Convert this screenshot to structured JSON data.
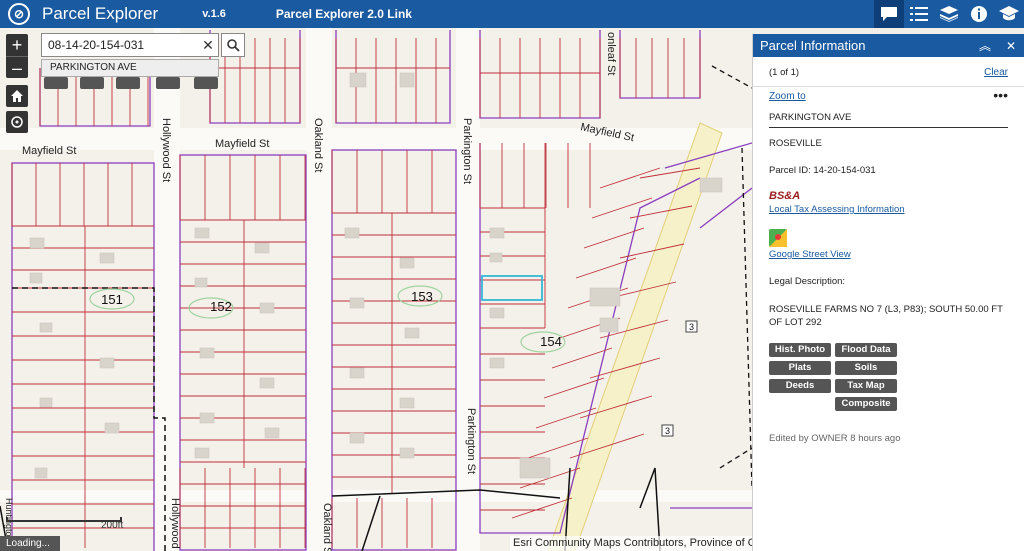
{
  "header": {
    "title": "Parcel Explorer",
    "version": "v.1.6",
    "link_label": "Parcel Explorer 2.0 Link"
  },
  "search": {
    "value": "08-14-20-154-031",
    "suggestion": "PARKINGTON AVE"
  },
  "map": {
    "zoom_in": "+",
    "zoom_out": "–",
    "scale_label": "200ft",
    "loading_text": "Loading...",
    "attribution": "Esri Community Maps Contributors, Province of Ontari",
    "streets": [
      "Mayfield St",
      "Mayfield St",
      "Hollywood St",
      "Oakland St",
      "Parkington St",
      "Parkington St",
      "Hollywood",
      "Oakland St",
      "Huntington",
      "Mayfield St",
      "onleaf St"
    ],
    "blocks": [
      "151",
      "152",
      "153",
      "154"
    ],
    "route_shields": [
      "3",
      "3"
    ]
  },
  "panel": {
    "title": "Parcel Information",
    "count": "(1 of 1)",
    "clear": "Clear",
    "zoom_to": "Zoom to",
    "address": "PARKINGTON AVE",
    "city": "ROSEVILLE",
    "parcel_id": "Parcel ID: 14-20-154-031",
    "bsa_logo": "BS&A",
    "tax_link": "Local Tax Assessing Information",
    "street_view_link": "Google Street View",
    "legal_label": "Legal Description:",
    "legal_text": "ROSEVILLE FARMS NO 7 (L3, P83); SOUTH 50.00 FT OF LOT 292",
    "buttons": {
      "hist_photo": "Hist. Photo",
      "flood_data": "Flood Data",
      "plats": "Plats",
      "soils": "Soils",
      "deeds": "Deeds",
      "tax_map": "Tax Map",
      "composite": "Composite"
    },
    "edited": "Edited by OWNER 8 hours ago"
  },
  "colors": {
    "header_blue": "#1a5aa1",
    "parcel_red": "#c0303a",
    "block_purple": "#8a3fbf",
    "selected_cyan": "#34b8d6"
  }
}
